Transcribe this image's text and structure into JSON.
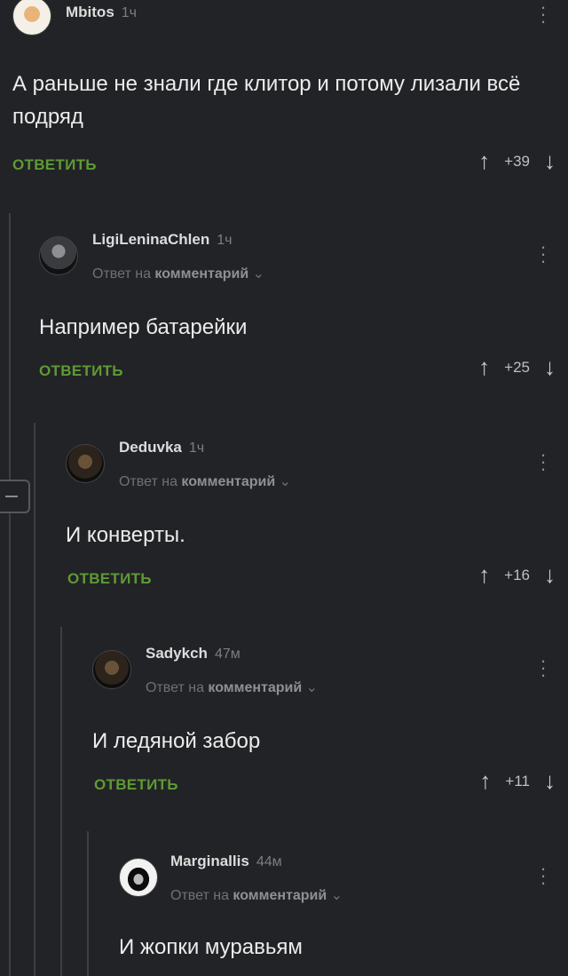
{
  "comments": [
    {
      "author": "Mbitos",
      "time": "1ч",
      "reply_prefix": "",
      "reply_target": "",
      "text": "А раньше не знали где клитор и потому лизали всё подряд",
      "reply_label": "ОТВЕТИТЬ",
      "score": "+39"
    },
    {
      "author": "LigiLeninaChlen",
      "time": "1ч",
      "reply_prefix": "Ответ на",
      "reply_target": "комментарий",
      "text": "Например батарейки",
      "reply_label": "ОТВЕТИТЬ",
      "score": "+25"
    },
    {
      "author": "Deduvka",
      "time": "1ч",
      "reply_prefix": "Ответ на",
      "reply_target": "комментарий",
      "text": "И конверты.",
      "reply_label": "ОТВЕТИТЬ",
      "score": "+16"
    },
    {
      "author": "Sadykch",
      "time": "47м",
      "reply_prefix": "Ответ на",
      "reply_target": "комментарий",
      "text": "И ледяной забор",
      "reply_label": "ОТВЕТИТЬ",
      "score": "+11"
    },
    {
      "author": "Marginallis",
      "time": "44м",
      "reply_prefix": "Ответ на",
      "reply_target": "комментарий",
      "text": "И жопки муравьям",
      "reply_label": "",
      "score": ""
    }
  ],
  "icons": {
    "upvote": "↑",
    "downvote": "↓",
    "more": "⋮",
    "chevron": "⌄"
  },
  "colors": {
    "accent": "#5e9a35",
    "background": "#222326"
  }
}
